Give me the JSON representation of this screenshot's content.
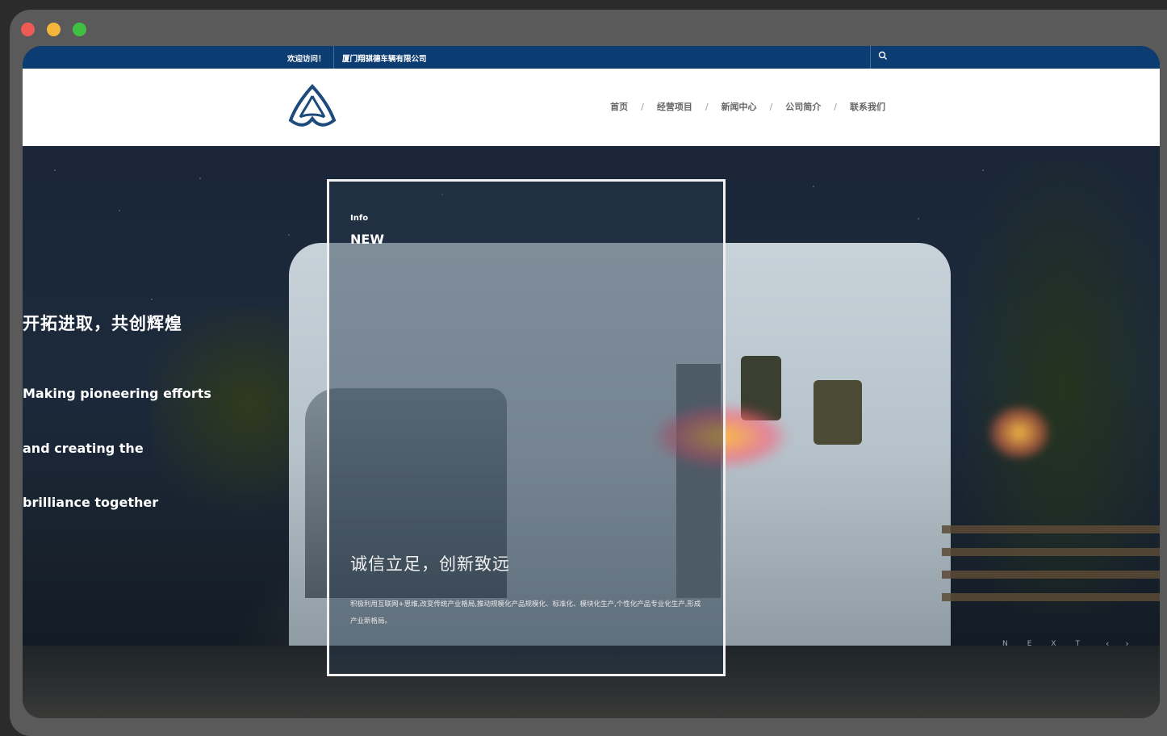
{
  "topbar": {
    "welcome": "欢迎访问！",
    "company": "厦门翔骐德车辆有限公司",
    "search_icon": "search-icon"
  },
  "navbar": {
    "logo_icon": "triangle-logo-icon",
    "items": [
      "首页",
      "经营项目",
      "新闻中心",
      "公司简介",
      "联系我们"
    ],
    "separator": "/"
  },
  "hero": {
    "title_cn": "开拓进取，共创辉煌",
    "lines_en": [
      "Making pioneering efforts",
      "and creating the",
      "brilliance together"
    ],
    "card": {
      "label": "Info",
      "heading": "NEW",
      "motto": "诚信立足，创新致远",
      "description": "积极利用互联网+思维,改变传统产业格局,推动规模化产品规模化、标准化、模块化生产,个性化产品专业化生产,形成产业新格局。"
    },
    "next_letters": [
      "N",
      "E",
      "X",
      "T"
    ],
    "arrows": [
      "‹",
      "›"
    ]
  },
  "colors": {
    "topbar_bg": "#0b3c72",
    "nav_bg": "#ffffff",
    "glow": "#ffb84a"
  }
}
